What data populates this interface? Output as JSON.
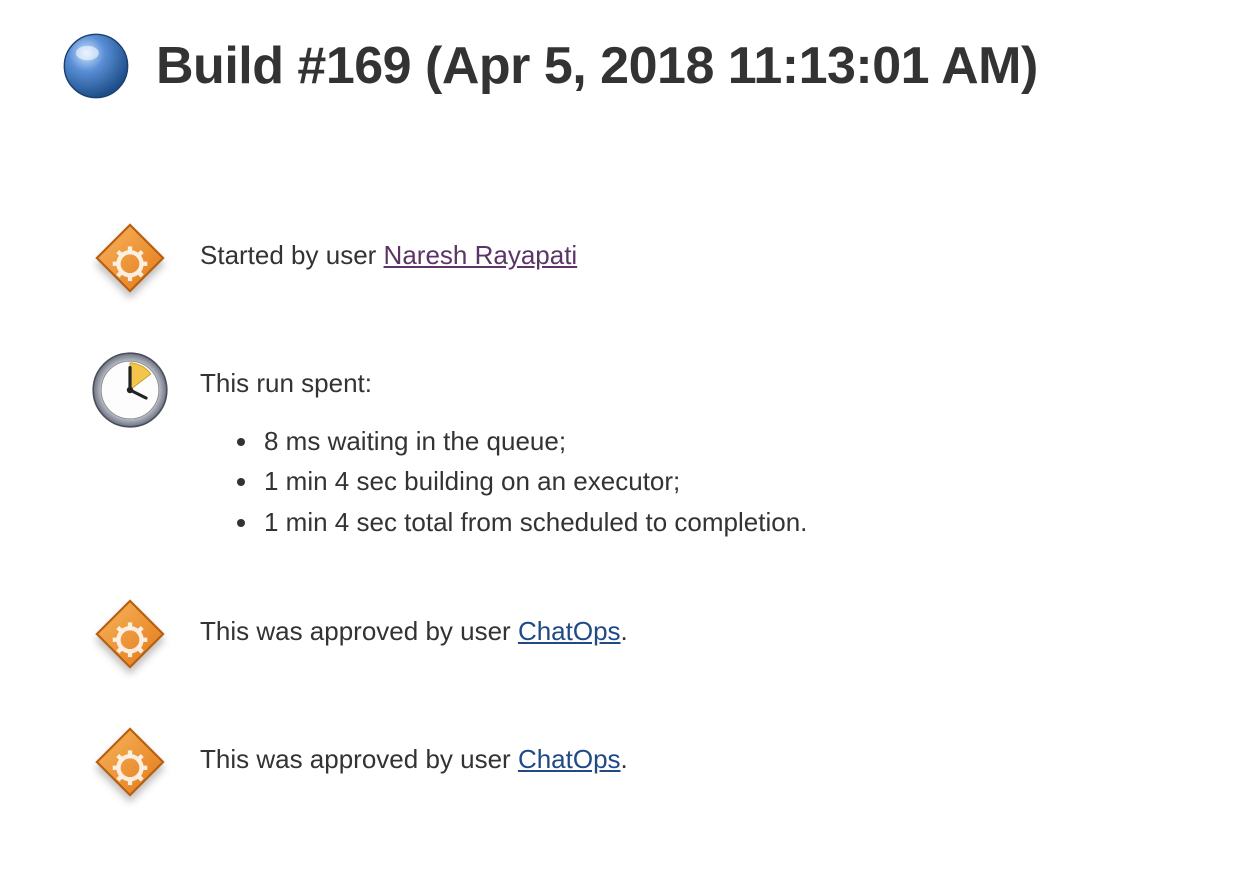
{
  "header": {
    "title": "Build #169 (Apr 5, 2018 11:13:01 AM)"
  },
  "entries": {
    "started_by": {
      "prefix": "Started by user ",
      "user": "Naresh Rayapati"
    },
    "run_spent": {
      "label": "This run spent:",
      "items": [
        "8 ms waiting in the queue;",
        "1 min 4 sec building on an executor;",
        "1 min 4 sec total from scheduled to completion."
      ]
    },
    "approved1": {
      "prefix": "This was approved by user ",
      "user": "ChatOps",
      "suffix": "."
    },
    "approved2": {
      "prefix": "This was approved by user ",
      "user": "ChatOps",
      "suffix": "."
    }
  }
}
